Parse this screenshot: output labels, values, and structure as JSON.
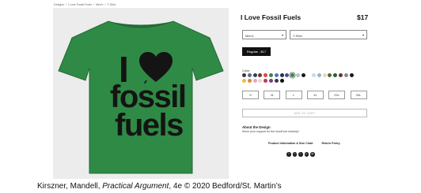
{
  "breadcrumb": [
    "Designs",
    "/",
    "I Love Fossil Fuels",
    "/",
    "Men's",
    "/",
    "T-Shirt"
  ],
  "product": {
    "title": "I Love Fossil Fuels",
    "price": "$17",
    "shirt_color": "#2f8a45",
    "shirt_text": {
      "i": "I",
      "fossil": "fossil",
      "fuels": "fuels",
      "heart_icon": "heart-icon"
    }
  },
  "options": {
    "style_select": "Men's",
    "type_select": "T-Shirt",
    "fit_button": "Regular - $17"
  },
  "color": {
    "label": "Color",
    "swatches_row1": [
      "#3a3a3a",
      "#5b6b8a",
      "#2d3f6a",
      "#7a2f2f",
      "#d9473d",
      "#3f7f4a",
      "#4a78b8",
      "#1f2f5a",
      "#5a4a8a",
      "#2f8a45",
      "#c0c0c0",
      "#1b1b1b"
    ],
    "swatches_row1b": [
      "#c9d9e8",
      "#8fb3d9",
      "#e7d9b8",
      "#4a6a3a",
      "#2d5a2d",
      "#6b2f3a",
      "#8a8a8a",
      "#1a1a1a"
    ],
    "swatches_row2": [
      "#e6c23a",
      "#d88a3a",
      "#e8a8b8",
      "#f0d0d8",
      "#b83a5a",
      "#7a3a8a",
      "#3a3a3a",
      "#111111"
    ]
  },
  "sizes": [
    "S",
    "M",
    "L",
    "XL",
    "2XL",
    "3XL"
  ],
  "add_to_cart": "ADD TO CART",
  "about": {
    "heading": "About the Design",
    "text": "Show your support for the fossil fuel industry!"
  },
  "links": [
    "Product Information & Size Chart",
    "Return Policy"
  ],
  "social_icons": [
    "facebook-icon",
    "tumblr-icon",
    "twitter-icon",
    "pinterest-icon",
    "email-icon"
  ],
  "caption": {
    "prefix": "Kirszner, Mandell, ",
    "book": "Practical Argument",
    "suffix": ", 4e © 2020 Bedford/St. Martin’s"
  }
}
